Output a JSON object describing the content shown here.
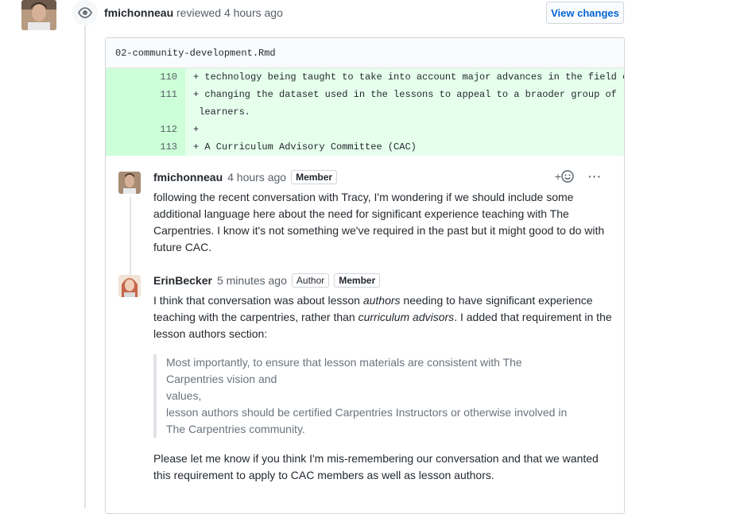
{
  "review": {
    "reviewer": "fmichonneau",
    "action": "reviewed",
    "time": "4 hours ago",
    "view_changes_label": "View changes"
  },
  "file": {
    "name": "02-community-development.Rmd",
    "lines": [
      {
        "num": "110",
        "code": "+ technology being taught to take into account major advances in the field or"
      },
      {
        "num": "111",
        "code": "+ changing the dataset used in the lessons to appeal to a braoder group of"
      },
      {
        "num": "",
        "code": " learners."
      },
      {
        "num": "112",
        "code": "+"
      },
      {
        "num": "113",
        "code": "+ A Curriculum Advisory Committee (CAC)"
      }
    ]
  },
  "comments": [
    {
      "author": "fmichonneau",
      "time": "4 hours ago",
      "labels": [
        "Member"
      ],
      "body": "following the recent conversation with Tracy, I'm wondering if we should include some additional language here about the need for significant experience teaching with The Carpentries. I know it's not something we've required in the past but it might good to do with future CAC."
    },
    {
      "author": "ErinBecker",
      "time": "5 minutes ago",
      "labels": [
        "Author",
        "Member"
      ],
      "body_parts": [
        "I think that conversation was about lesson ",
        "authors",
        " needing to have significant experience teaching with the carpentries, rather than ",
        "curriculum advisors",
        ". I added that requirement in the lesson authors section:"
      ],
      "quote_lines": [
        "Most importantly, to ensure that lesson materials are consistent with The Carpentries vision and",
        "values,",
        "lesson authors should be certified Carpentries Instructors or otherwise involved in The Carpentries community."
      ],
      "body2": "Please let me know if you think I'm mis-remembering our conversation and that we wanted this requirement to apply to CAC members as well as lesson authors."
    }
  ],
  "actions": {
    "reaction_plus": "+",
    "more": "···"
  },
  "icons": [
    "eye-icon",
    "smiley-icon",
    "kebab-icon"
  ],
  "colors": {
    "link": "#0366d6",
    "diff_add_bg": "#e6ffed",
    "diff_add_num_bg": "#cdffd8"
  }
}
